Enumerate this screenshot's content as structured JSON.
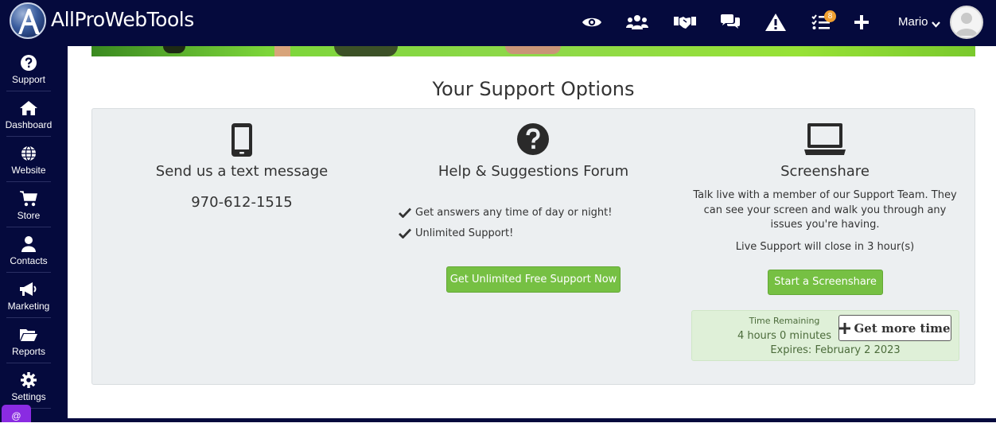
{
  "header": {
    "brand": "AllProWebTools",
    "notification_count": "8",
    "user_name": "Mario",
    "icons": [
      "eye-icon",
      "users-icon",
      "handshake-icon",
      "chat-icon",
      "warning-icon",
      "tasks-icon",
      "plus-icon"
    ]
  },
  "sidebar": {
    "items": [
      {
        "label": "Support",
        "icon": "question-circle-icon"
      },
      {
        "label": "Dashboard",
        "icon": "home-icon"
      },
      {
        "label": "Website",
        "icon": "globe-icon"
      },
      {
        "label": "Store",
        "icon": "cart-icon"
      },
      {
        "label": "Contacts",
        "icon": "user-icon"
      },
      {
        "label": "Marketing",
        "icon": "megaphone-icon"
      },
      {
        "label": "Reports",
        "icon": "folder-icon"
      },
      {
        "label": "Settings",
        "icon": "gear-icon"
      }
    ],
    "chip": "@"
  },
  "main": {
    "title": "Your Support Options",
    "text_column": {
      "title": "Send us a text message",
      "phone": "970-612-1515"
    },
    "forum_column": {
      "title": "Help & Suggestions Forum",
      "checks": [
        "Get answers any time of day or night!",
        "Unlimited Support!"
      ],
      "button": "Get Unlimited Free Support Now"
    },
    "screenshare_column": {
      "title": "Screenshare",
      "description": "Talk live with a member of our Support Team. They can see your screen and walk you through any issues you're having.",
      "close_note": "Live Support will close in 3 hour(s)",
      "button": "Start a Screenshare",
      "time_remaining_label": "Time Remaining",
      "time_remaining_value": "4 hours 0 minutes",
      "expires": "Expires: February 2 2023",
      "more_time_button": "Get more time"
    }
  },
  "colors": {
    "navbar": "#050a3d",
    "accent_green": "#76c043",
    "panel_bg": "#eceff1",
    "badge": "#f0a030"
  }
}
